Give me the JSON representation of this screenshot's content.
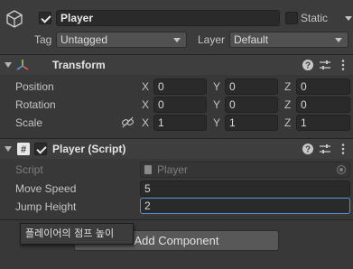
{
  "header": {
    "active_checked": true,
    "object_name": "Player",
    "static_label": "Static",
    "tag_label": "Tag",
    "tag_value": "Untagged",
    "layer_label": "Layer",
    "layer_value": "Default",
    "icon": "cube-icon"
  },
  "transform": {
    "title": "Transform",
    "icon": "transform-axes-icon",
    "rows": [
      {
        "label": "Position",
        "x": "0",
        "y": "0",
        "z": "0"
      },
      {
        "label": "Rotation",
        "x": "0",
        "y": "0",
        "z": "0"
      },
      {
        "label": "Scale",
        "x": "1",
        "y": "1",
        "z": "1"
      }
    ],
    "axes": {
      "x": "X",
      "y": "Y",
      "z": "Z"
    }
  },
  "script_component": {
    "title": "Player (Script)",
    "enabled": true,
    "script_label": "Script",
    "script_value": "Player",
    "fields": [
      {
        "label": "Move Speed",
        "value": "5"
      },
      {
        "label": "Jump Height",
        "value": "2"
      }
    ]
  },
  "add_component_label": "Add Component",
  "tooltip": "플레이어의 점프 높이",
  "colors": {
    "background": "#383838",
    "header_bg": "#3e3e3e",
    "field_bg": "#2a2a2a",
    "text": "#c4c4c4"
  }
}
